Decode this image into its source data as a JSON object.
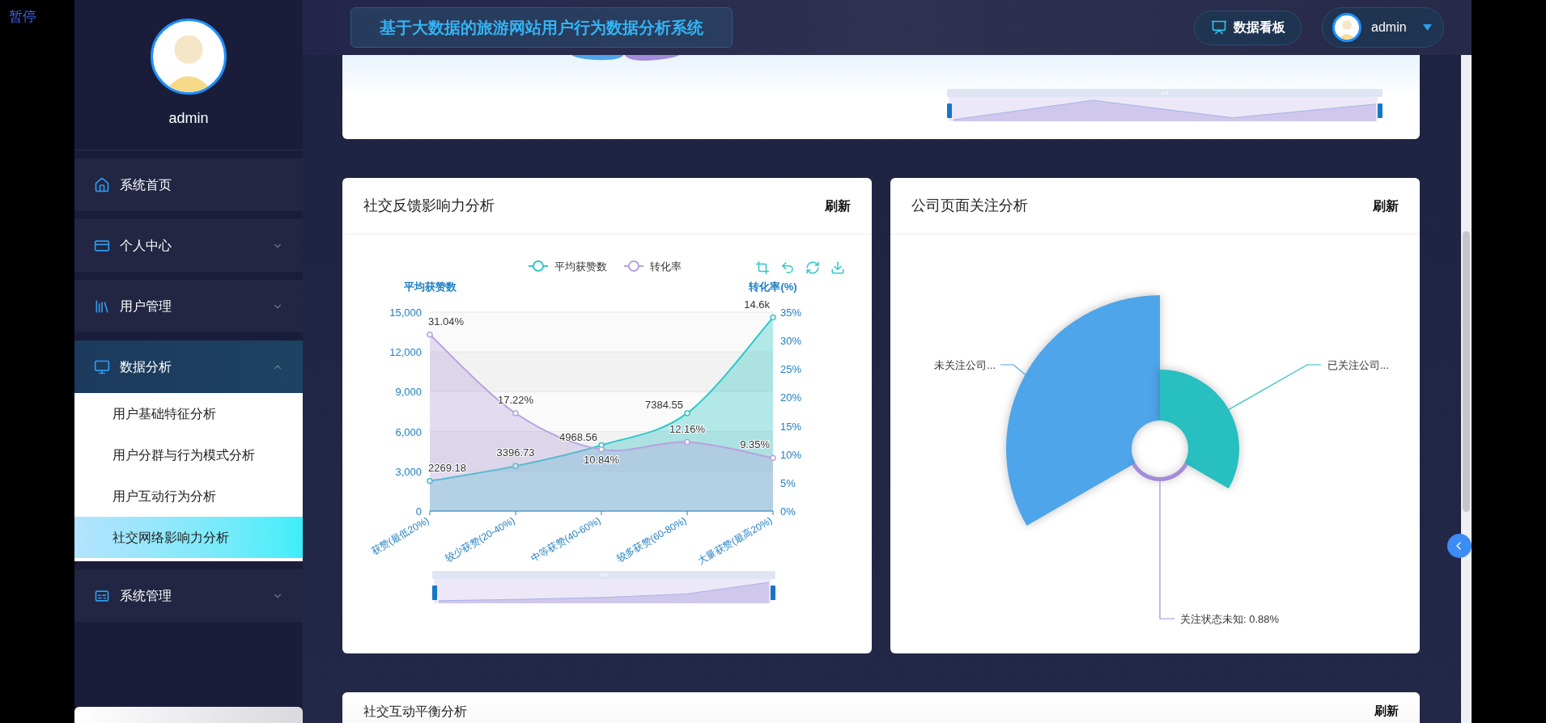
{
  "overlay_label": "暂停",
  "sidebar": {
    "user_name": "admin",
    "menu": [
      {
        "label": "系统首页",
        "selected": false
      },
      {
        "label": "个人中心",
        "selected": false,
        "expanded": false
      },
      {
        "label": "用户管理",
        "selected": false,
        "expanded": false
      },
      {
        "label": "数据分析",
        "selected": true,
        "expanded": true,
        "children": [
          {
            "label": "用户基础特征分析",
            "selected": false
          },
          {
            "label": "用户分群与行为模式分析",
            "selected": false
          },
          {
            "label": "用户互动行为分析",
            "selected": false
          },
          {
            "label": "社交网络影响力分析",
            "selected": true
          }
        ]
      },
      {
        "label": "系统管理",
        "selected": false,
        "expanded": false
      }
    ]
  },
  "header": {
    "title": "基于大数据的旅游网站用户行为数据分析系统",
    "dashboard_button": "数据看板",
    "user_name": "admin"
  },
  "social_card": {
    "title": "社交反馈影响力分析",
    "refresh": "刷新",
    "chart_data": {
      "type": "area",
      "categories": [
        "获赞(最低20%)",
        "较少获赞(20-40%)",
        "中等获赞(40-60%)",
        "较多获赞(60-80%)",
        "大量获赞(最高20%)"
      ],
      "ylabel": "平均获赞数",
      "y2label": "转化率(%)",
      "ylim": [
        0,
        15000
      ],
      "y2lim": [
        0,
        35
      ],
      "yticks": [
        {
          "value": 0,
          "label": "0"
        },
        {
          "value": 3000,
          "label": "3,000"
        },
        {
          "value": 6000,
          "label": "6,000"
        },
        {
          "value": 9000,
          "label": "9,000"
        },
        {
          "value": 12000,
          "label": "12,000"
        },
        {
          "value": 15000,
          "label": "15,000"
        }
      ],
      "y2ticks": [
        {
          "value": 0,
          "label": "0%"
        },
        {
          "value": 5,
          "label": "5%"
        },
        {
          "value": 10,
          "label": "10%"
        },
        {
          "value": 15,
          "label": "15%"
        },
        {
          "value": 20,
          "label": "20%"
        },
        {
          "value": 25,
          "label": "25%"
        },
        {
          "value": 30,
          "label": "30%"
        },
        {
          "value": 35,
          "label": "35%"
        }
      ],
      "series": [
        {
          "name": "平均获赞数",
          "color": "#2ec7c9",
          "values": [
            2269.18,
            3396.73,
            4968.56,
            7384.55,
            14600
          ],
          "value_labels": [
            "2269.18",
            "3396.73",
            "4968.56",
            "7384.55",
            "14.6k"
          ]
        },
        {
          "name": "转化率",
          "color": "#b6a2de",
          "axis": "y2",
          "values": [
            31.04,
            17.22,
            10.84,
            12.16,
            9.35
          ],
          "value_labels": [
            "31.04%",
            "17.22%",
            "10.84%",
            "12.16%",
            "9.35%"
          ]
        }
      ],
      "grid": true,
      "legend": true
    }
  },
  "follow_card": {
    "title": "公司页面关注分析",
    "refresh": "刷新",
    "segments": [
      {
        "label": "未关注公司...",
        "color": "#4ea5e9"
      },
      {
        "label": "已关注公司...",
        "color": "#27bfc0"
      },
      {
        "label": "关注状态未知: 0.88%",
        "color": "#a38bd9"
      }
    ]
  },
  "balance_card": {
    "title": "社交互动平衡分析",
    "refresh": "刷新"
  }
}
